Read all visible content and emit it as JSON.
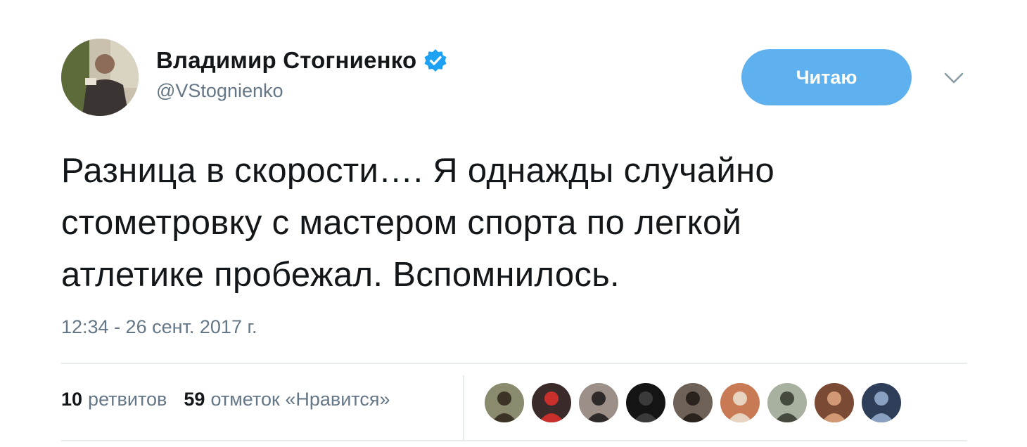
{
  "user": {
    "display_name": "Владимир Стогниенко",
    "handle": "@VStognienko",
    "verified_icon": "verified-badge-icon",
    "avatar_icon": "avatar"
  },
  "actions": {
    "follow_label": "Читаю",
    "more_icon": "chevron-down-icon"
  },
  "tweet": {
    "text_lines": [
      "Разница в скорости…. Я однажды случайно",
      "стометровку с мастером спорта по легкой",
      "атлетике пробежал. Вспомнилось."
    ],
    "timestamp": "12:34 - 26 сент. 2017 г."
  },
  "stats": {
    "retweets_count": "10",
    "retweets_label": "ретвитов",
    "likes_count": "59",
    "likes_label": "отметок «Нравится»"
  },
  "likers": [
    {
      "name": "liker-avatar-1",
      "bg": "#8a8a6e",
      "fg": "#3b3325"
    },
    {
      "name": "liker-avatar-2",
      "bg": "#3a2a2a",
      "fg": "#c9302c"
    },
    {
      "name": "liker-avatar-3",
      "bg": "#9b8f87",
      "fg": "#2f2a2a"
    },
    {
      "name": "liker-avatar-4",
      "bg": "#141414",
      "fg": "#3a3a3a"
    },
    {
      "name": "liker-avatar-5",
      "bg": "#6e6157",
      "fg": "#2a221d"
    },
    {
      "name": "liker-avatar-6",
      "bg": "#c87a55",
      "fg": "#e8d2c0"
    },
    {
      "name": "liker-avatar-7",
      "bg": "#a8b0a0",
      "fg": "#444a3e"
    },
    {
      "name": "liker-avatar-8",
      "bg": "#7a4a35",
      "fg": "#d29a74"
    },
    {
      "name": "liker-avatar-9",
      "bg": "#2e3e58",
      "fg": "#8aa0c0"
    }
  ],
  "colors": {
    "accent": "#5fb0ef",
    "verified": "#1da1f2",
    "secondary_text": "#657786",
    "primary_text": "#14171a",
    "divider": "#e6ecf0"
  }
}
